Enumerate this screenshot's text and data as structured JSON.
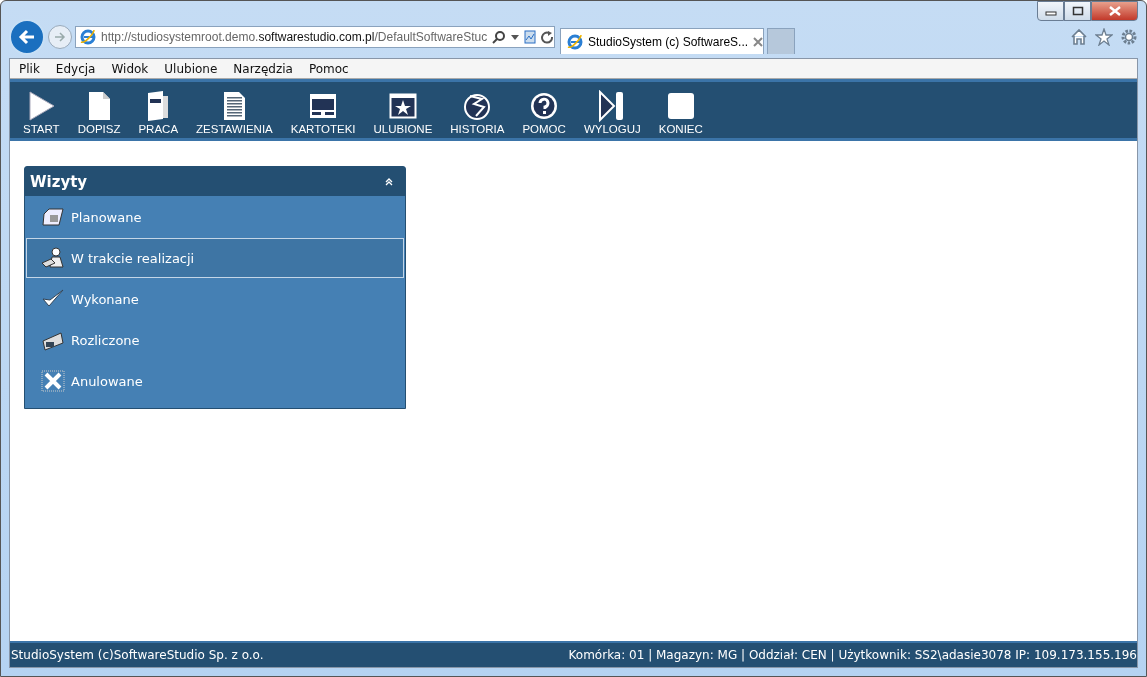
{
  "browser": {
    "url_start": "http://studiosystemroot.demo.",
    "url_host": "softwarestudio.com.pl",
    "url_end": "/DefaultSoftwareStuc",
    "tab_title": "StudioSystem (c) SoftwareS..."
  },
  "menu": [
    "Plik",
    "Edycja",
    "Widok",
    "Ulubione",
    "Narzędzia",
    "Pomoc"
  ],
  "toolbar": [
    {
      "kind": "start",
      "label": "START"
    },
    {
      "kind": "document",
      "label": "DOPISZ"
    },
    {
      "kind": "binder",
      "label": "PRACA"
    },
    {
      "kind": "report",
      "label": "ZESTAWIENIA"
    },
    {
      "kind": "window",
      "label": "KARTOTEKI"
    },
    {
      "kind": "favorite",
      "label": "ULUBIONE"
    },
    {
      "kind": "history",
      "label": "HISTORIA"
    },
    {
      "kind": "help",
      "label": "POMOC"
    },
    {
      "kind": "logout",
      "label": "WYLOGUJ"
    },
    {
      "kind": "stop",
      "label": "KONIEC"
    }
  ],
  "panel": {
    "title": "Wizyty",
    "expanded": true,
    "items": [
      {
        "kind": "phone",
        "label": "Planowane",
        "selected": false
      },
      {
        "kind": "worker",
        "label": "W trakcie realizacji",
        "selected": true
      },
      {
        "kind": "check",
        "label": "Wykonane",
        "selected": false
      },
      {
        "kind": "money",
        "label": "Rozliczone",
        "selected": false
      },
      {
        "kind": "cancel",
        "label": "Anulowane",
        "selected": false
      }
    ]
  },
  "status_bar": {
    "left": "StudioSystem (c)SoftwareStudio Sp. z o.o.",
    "right": "Komórka: 01 | Magazyn: MG | Oddział: CEN | Użytkownik: SS2\\adasie3078 IP: 109.173.155.196"
  }
}
